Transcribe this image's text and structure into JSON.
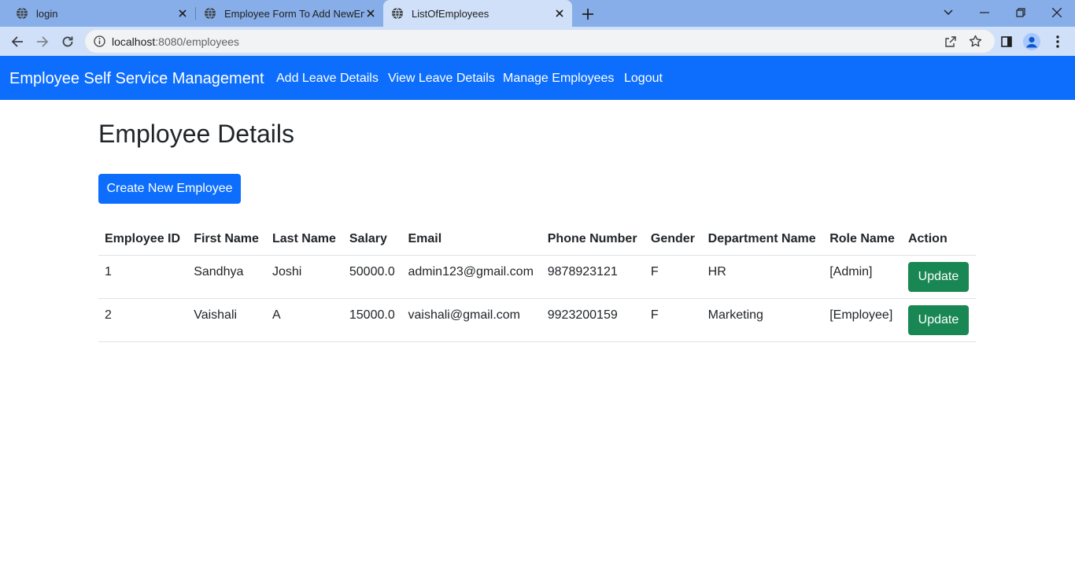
{
  "browser": {
    "tabs": [
      {
        "title": "login"
      },
      {
        "title": "Employee Form To Add NewEmp"
      },
      {
        "title": "ListOfEmployees"
      }
    ],
    "url_host": "localhost",
    "url_path": ":8080/employees"
  },
  "navbar": {
    "brand": "Employee Self Service Management",
    "links": [
      "Add Leave Details",
      "View Leave Details",
      "Manage Employees",
      "Logout"
    ]
  },
  "main": {
    "title": "Employee Details",
    "create_label": "Create New Employee",
    "table": {
      "headers": [
        "Employee ID",
        "First Name",
        "Last Name",
        "Salary",
        "Email",
        "Phone Number",
        "Gender",
        "Department Name",
        "Role Name",
        "Action"
      ],
      "rows": [
        [
          "1",
          "Sandhya",
          "Joshi",
          "50000.0",
          "admin123@gmail.com",
          "9878923121",
          "F",
          "HR",
          "[Admin]",
          "Update"
        ],
        [
          "2",
          "Vaishali",
          "A",
          "15000.0",
          "vaishali@gmail.com",
          "9923200159",
          "F",
          "Marketing",
          "[Employee]",
          "Update"
        ]
      ]
    }
  },
  "colors": {
    "primary": "#0d6efd",
    "success": "#198754",
    "tabstrip": "#87aee8",
    "toolbar": "#cfe0f8"
  }
}
